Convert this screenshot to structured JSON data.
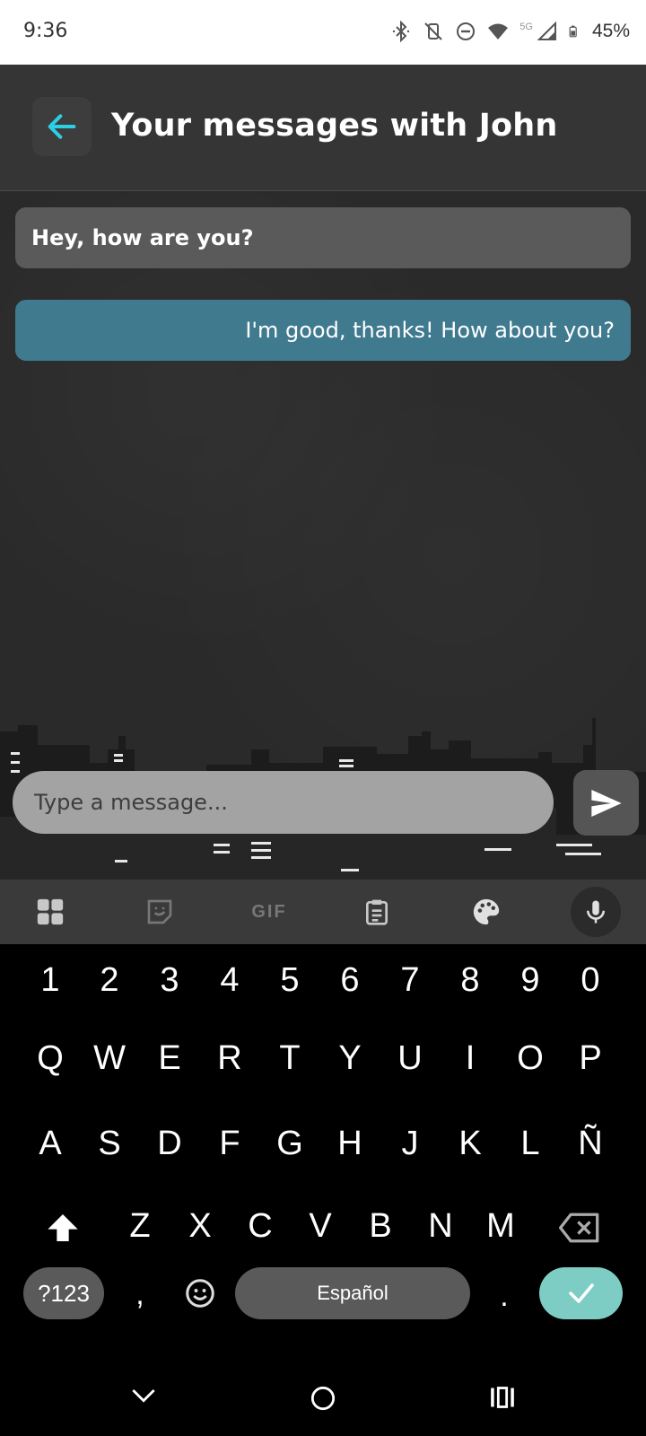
{
  "status_bar": {
    "time": "9:36",
    "network": "5G",
    "battery": "45%",
    "icons": [
      "bluetooth-icon",
      "vibrate-off-icon",
      "do-not-disturb-icon",
      "wifi-icon",
      "cellular-signal-icon",
      "battery-icon"
    ]
  },
  "header": {
    "back_icon": "arrow-left-icon",
    "title": "Your messages with John"
  },
  "messages": [
    {
      "direction": "incoming",
      "text": "Hey, how are you?"
    },
    {
      "direction": "outgoing",
      "text": "I'm good, thanks! How about you?"
    }
  ],
  "composer": {
    "placeholder": "Type a message...",
    "value": "",
    "send_icon": "send-icon"
  },
  "keyboard": {
    "toolbar": [
      "apps-grid-icon",
      "sticker-icon",
      "gif-icon",
      "clipboard-icon",
      "palette-icon",
      "microphone-icon"
    ],
    "gif_label": "GIF",
    "number_row": [
      "1",
      "2",
      "3",
      "4",
      "5",
      "6",
      "7",
      "8",
      "9",
      "0"
    ],
    "row1": [
      "Q",
      "W",
      "E",
      "R",
      "T",
      "Y",
      "U",
      "I",
      "O",
      "P"
    ],
    "row2": [
      "A",
      "S",
      "D",
      "F",
      "G",
      "H",
      "J",
      "K",
      "L",
      "Ñ"
    ],
    "row3": [
      "Z",
      "X",
      "C",
      "V",
      "B",
      "N",
      "M"
    ],
    "symbols_label": "?123",
    "comma": ",",
    "space_label": "Español",
    "period": ".",
    "enter_icon": "checkmark-icon"
  },
  "nav_bar": [
    "chevron-down-icon",
    "home-circle-icon",
    "recents-icon"
  ],
  "colors": {
    "accent_cyan": "#2bd0e6",
    "outgoing_bubble": "#3f7a8f",
    "incoming_bubble": "#5a5a5a",
    "enter_key": "#7ecdc4"
  }
}
